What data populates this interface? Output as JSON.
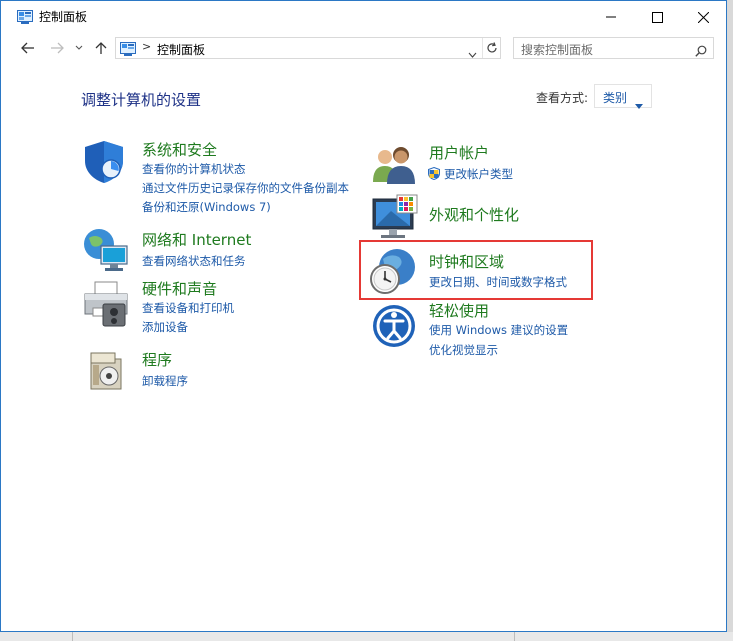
{
  "window": {
    "title": "控制面板"
  },
  "address": {
    "path": "控制面板",
    "separator": ">"
  },
  "search": {
    "placeholder": "搜索控制面板"
  },
  "main": {
    "heading": "调整计算机的设置",
    "view_label": "查看方式:",
    "view_value": "类别"
  },
  "categories": {
    "system": {
      "title": "系统和安全",
      "links": [
        "查看你的计算机状态",
        "通过文件历史记录保存你的文件备份副本",
        "备份和还原(Windows 7)"
      ]
    },
    "network": {
      "title": "网络和 Internet",
      "links": [
        "查看网络状态和任务"
      ]
    },
    "hardware": {
      "title": "硬件和声音",
      "links": [
        "查看设备和打印机",
        "添加设备"
      ]
    },
    "programs": {
      "title": "程序",
      "links": [
        "卸载程序"
      ]
    },
    "accounts": {
      "title": "用户帐户",
      "links": [
        "更改帐户类型"
      ]
    },
    "appearance": {
      "title": "外观和个性化",
      "links": []
    },
    "clock": {
      "title": "时钟和区域",
      "links": [
        "更改日期、时间或数字格式"
      ]
    },
    "ease": {
      "title": "轻松使用",
      "links": [
        "使用 Windows 建议的设置",
        "优化视觉显示"
      ]
    }
  },
  "colors": {
    "category_title": "#1e7a1e",
    "link": "#1e5aa8",
    "heading": "#1e3287",
    "highlight_border": "#e53935",
    "window_border": "#2b78c5"
  }
}
